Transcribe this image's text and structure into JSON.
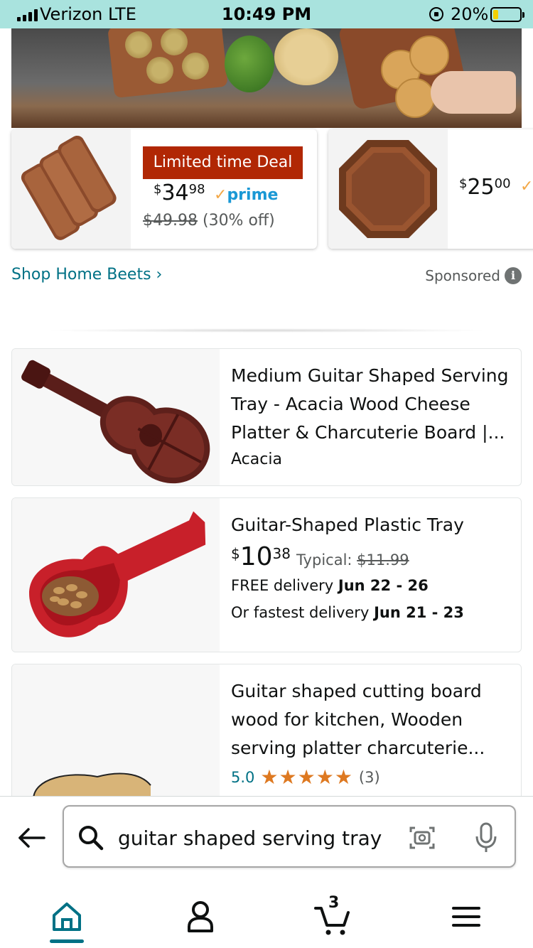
{
  "status_bar": {
    "carrier": "Verizon  LTE",
    "time": "10:49 PM",
    "battery_pct": "20%",
    "battery_level": 0.2
  },
  "deals": [
    {
      "badge": "Limited time Deal",
      "price_currency": "$",
      "price_whole": "34",
      "price_fraction": "98",
      "prime_label": "prime",
      "was_price": "$49.98",
      "discount": "(30% off)"
    },
    {
      "price_currency": "$",
      "price_whole": "25",
      "price_fraction": "00"
    }
  ],
  "shop_link": "Shop Home Beets ›",
  "sponsored": "Sponsored",
  "products": [
    {
      "title": "Medium Guitar Shaped Serving Tray - Acacia Wood Cheese Platter & Charcuterie Board |...",
      "brand": "Acacia"
    },
    {
      "title": "Guitar-Shaped Plastic Tray",
      "price_currency": "$",
      "price_whole": "10",
      "price_fraction": "38",
      "typical_label": "Typical:",
      "typical_price": "$11.99",
      "free_delivery_label": "FREE delivery",
      "free_delivery_dates": "Jun 22 - 26",
      "fastest_label": "Or fastest delivery",
      "fastest_dates": "Jun 21 - 23"
    },
    {
      "title": "Guitar shaped cutting board wood for kitchen, Wooden serving platter charcuterie...",
      "rating": "5.0",
      "rating_count": "(3)"
    }
  ],
  "search": {
    "query": "guitar shaped serving tray"
  },
  "nav": {
    "cart_count": "3"
  },
  "colors": {
    "status_bar_bg": "#a9e3de",
    "deal_badge": "#b12704",
    "link": "#007185",
    "prime": "#1a98d5",
    "stars": "#de7921"
  }
}
